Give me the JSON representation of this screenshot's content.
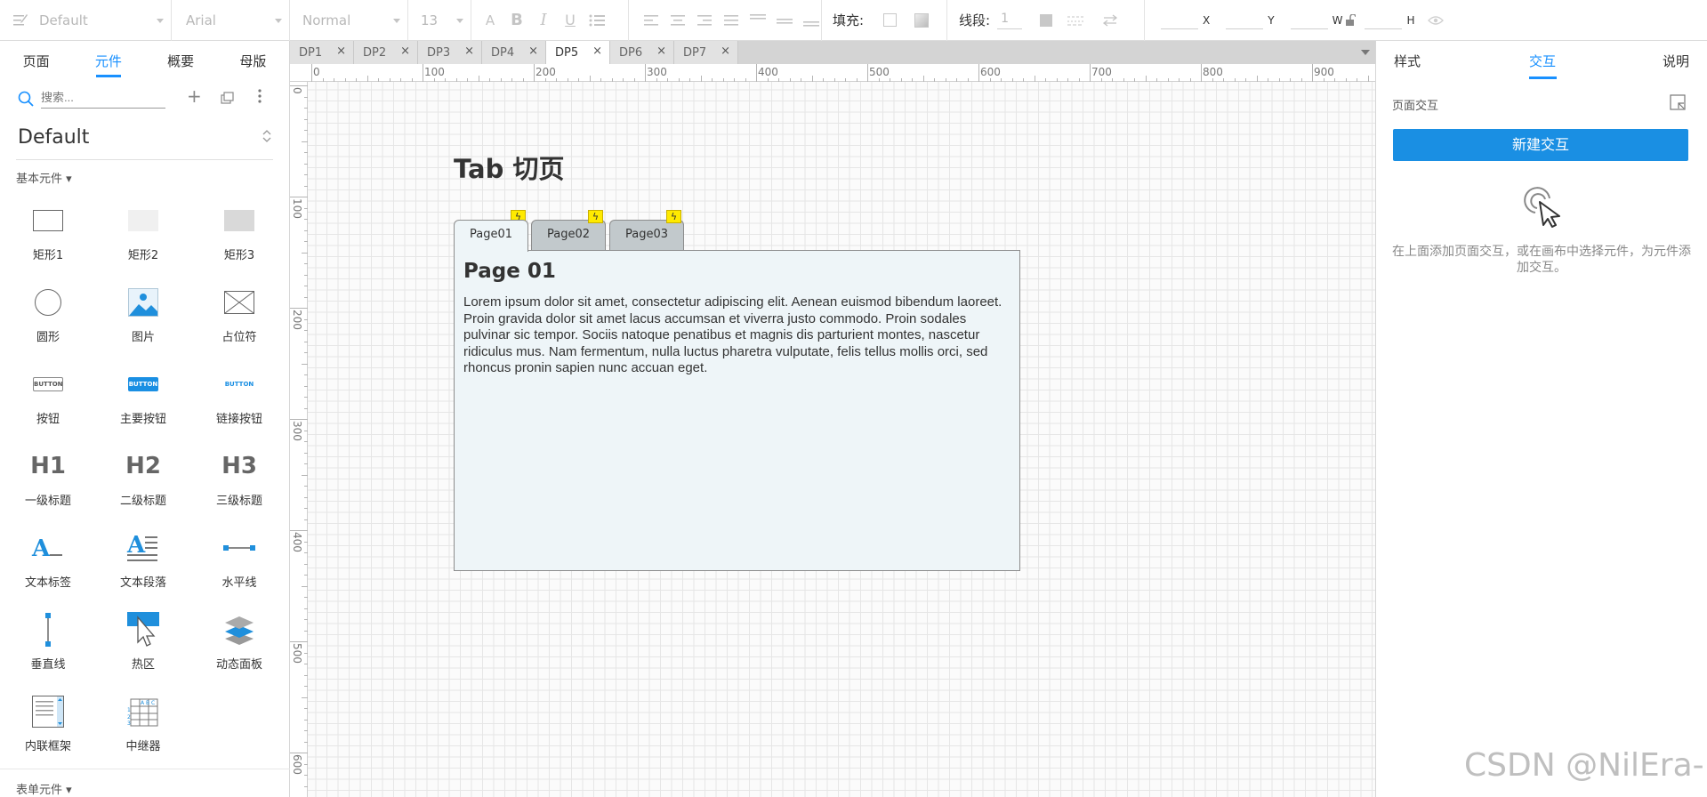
{
  "toolbar": {
    "style_select": "Default",
    "font_select": "Arial",
    "weight_select": "Normal",
    "size_select": "13",
    "fill_label": "填充:",
    "line_label": "线段:",
    "line_value": "1",
    "x_label": "X",
    "y_label": "Y",
    "w_label": "W",
    "h_label": "H"
  },
  "left": {
    "tabs": [
      "页面",
      "元件",
      "概要",
      "母版"
    ],
    "active_tab": "元件",
    "search_placeholder": "搜索...",
    "library": "Default",
    "basic_section": "基本元件 ▾",
    "form_section": "表单元件 ▾",
    "components": [
      "矩形1",
      "矩形2",
      "矩形3",
      "圆形",
      "图片",
      "占位符",
      "按钮",
      "主要按钮",
      "链接按钮",
      "一级标题",
      "二级标题",
      "三级标题",
      "文本标签",
      "文本段落",
      "水平线",
      "垂直线",
      "热区",
      "动态面板",
      "内联框架",
      "中继器"
    ],
    "heading_icons": [
      "H1",
      "H2",
      "H3"
    ],
    "button_icon_text": "BUTTON"
  },
  "page_tabs": [
    "DP1",
    "DP2",
    "DP3",
    "DP4",
    "DP5",
    "DP6",
    "DP7"
  ],
  "active_page_tab": "DP5",
  "ruler": {
    "h": [
      "0",
      "100",
      "200",
      "300",
      "400",
      "500",
      "600",
      "700",
      "800",
      "900"
    ],
    "v": [
      "0",
      "100",
      "200",
      "300",
      "400",
      "500",
      "600"
    ]
  },
  "canvas": {
    "title": "Tab 切页",
    "tabs": [
      "Page01",
      "Page02",
      "Page03"
    ],
    "active_tab": "Page01",
    "content_heading": "Page 01",
    "content_text": "Lorem ipsum dolor sit amet, consectetur adipiscing elit. Aenean euismod bibendum laoreet. Proin gravida dolor sit amet lacus accumsan et viverra justo commodo. Proin sodales pulvinar sic tempor. Sociis natoque penatibus et magnis dis parturient montes, nascetur ridiculus mus. Nam fermentum, nulla luctus pharetra vulputate, felis tellus mollis orci, sed rhoncus pronin sapien nunc accuan eget."
  },
  "right": {
    "tabs": [
      "样式",
      "交互",
      "说明"
    ],
    "active_tab": "交互",
    "section_label": "页面交互",
    "new_button": "新建交互",
    "hint": "在上面添加页面交互，或在画布中选择元件，为元件添加交互。"
  },
  "watermark": "CSDN @NilEra-K",
  "colors": {
    "accent": "#1890ff",
    "primary_button": "#1a8fe3",
    "tab_active_bg": "#eef5f8",
    "tab_inactive_bg": "#c2c9cc",
    "lightning": "#ffea00"
  }
}
